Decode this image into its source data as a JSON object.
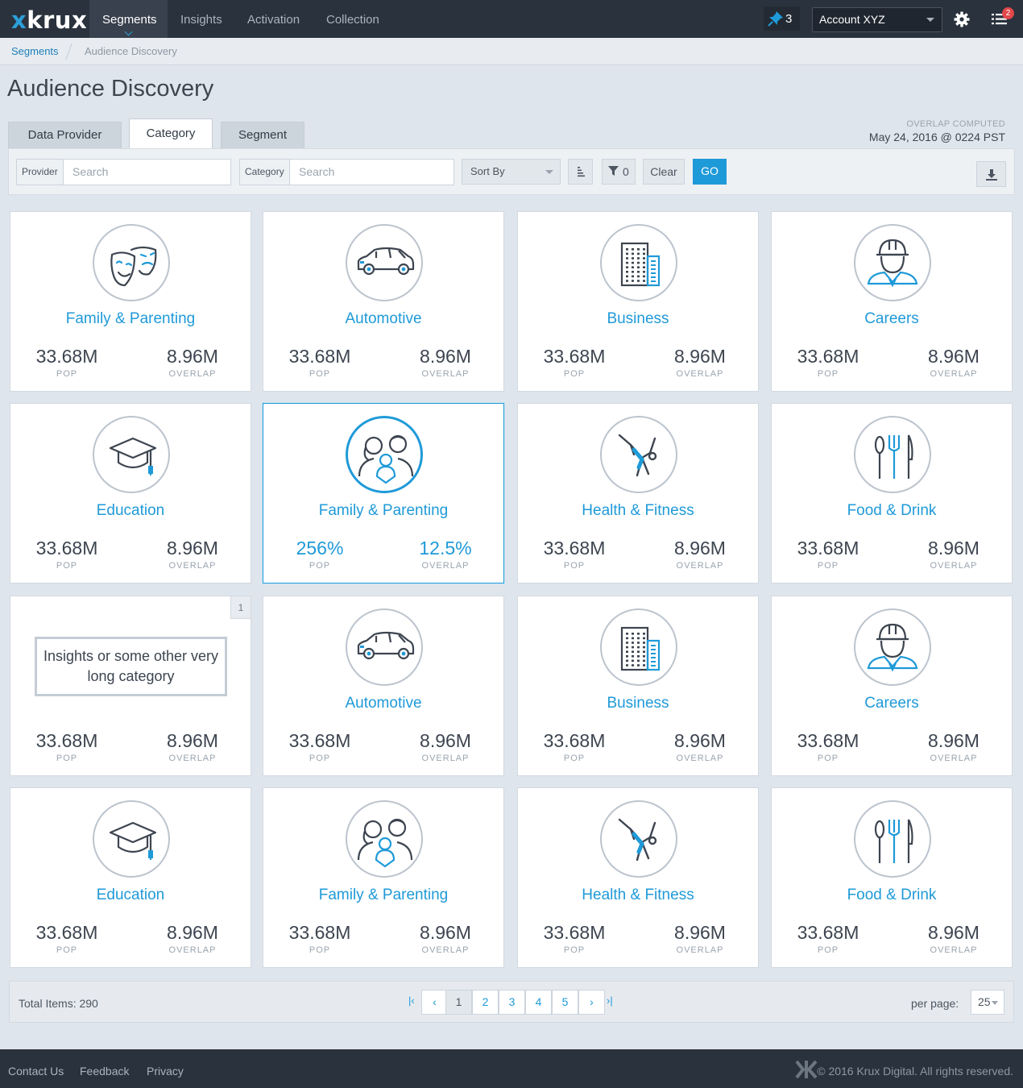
{
  "nav": {
    "logo": "krux",
    "items": [
      "Segments",
      "Insights",
      "Activation",
      "Collection"
    ],
    "pin_count": "3",
    "account": "Account XYZ",
    "notif_count": "2"
  },
  "breadcrumb": {
    "root": "Segments",
    "current": "Audience Discovery"
  },
  "page_title": "Audience Discovery",
  "tabs": [
    "Data Provider",
    "Category",
    "Segment"
  ],
  "overlap": {
    "label": "OVERLAP COMPUTED",
    "date": "May 24, 2016 @ 0224 PST"
  },
  "filters": {
    "provider_label": "Provider",
    "provider_placeholder": "Search",
    "category_label": "Category",
    "category_placeholder": "Search",
    "sort_label": "Sort By",
    "filter_count": "0",
    "clear_label": "Clear",
    "go_label": "GO"
  },
  "stat_labels": {
    "pop": "POP",
    "overlap": "OVERLAP"
  },
  "cards": [
    {
      "title": "Family & Parenting",
      "icon": "theater-masks-icon",
      "pop": "33.68M",
      "overlap": "8.96M"
    },
    {
      "title": "Automotive",
      "icon": "car-icon",
      "pop": "33.68M",
      "overlap": "8.96M"
    },
    {
      "title": "Business",
      "icon": "building-icon",
      "pop": "33.68M",
      "overlap": "8.96M"
    },
    {
      "title": "Careers",
      "icon": "worker-icon",
      "pop": "33.68M",
      "overlap": "8.96M"
    },
    {
      "title": "Education",
      "icon": "graduation-cap-icon",
      "pop": "33.68M",
      "overlap": "8.96M"
    },
    {
      "title": "Family & Parenting",
      "icon": "family-icon",
      "pop": "256%",
      "overlap": "12.5%",
      "selected": true
    },
    {
      "title": "Health & Fitness",
      "icon": "gymnast-icon",
      "pop": "33.68M",
      "overlap": "8.96M"
    },
    {
      "title": "Food & Drink",
      "icon": "cutlery-icon",
      "pop": "33.68M",
      "overlap": "8.96M"
    },
    {
      "title": "Insights or some other very long category",
      "icon": "",
      "pop": "33.68M",
      "overlap": "8.96M",
      "badge": "1"
    },
    {
      "title": "Automotive",
      "icon": "car-icon",
      "pop": "33.68M",
      "overlap": "8.96M"
    },
    {
      "title": "Business",
      "icon": "building-icon",
      "pop": "33.68M",
      "overlap": "8.96M"
    },
    {
      "title": "Careers",
      "icon": "worker-icon",
      "pop": "33.68M",
      "overlap": "8.96M"
    },
    {
      "title": "Education",
      "icon": "graduation-cap-icon",
      "pop": "33.68M",
      "overlap": "8.96M"
    },
    {
      "title": "Family & Parenting",
      "icon": "family-icon",
      "pop": "33.68M",
      "overlap": "8.96M"
    },
    {
      "title": "Health & Fitness",
      "icon": "gymnast-icon",
      "pop": "33.68M",
      "overlap": "8.96M"
    },
    {
      "title": "Food & Drink",
      "icon": "cutlery-icon",
      "pop": "33.68M",
      "overlap": "8.96M"
    }
  ],
  "pagination": {
    "total": "Total Items: 290",
    "pages": [
      "1",
      "2",
      "3",
      "4",
      "5"
    ],
    "current": "1",
    "per_page_label": "per page:",
    "per_page": "25"
  },
  "footer": {
    "links": [
      "Contact Us",
      "Feedback",
      "Privacy"
    ],
    "copyright": "© 2016 Krux Digital. All rights reserved."
  },
  "colors": {
    "accent": "#1f9ad8",
    "nav_bg": "#2a323d",
    "page_bg": "#dfe5ec"
  }
}
